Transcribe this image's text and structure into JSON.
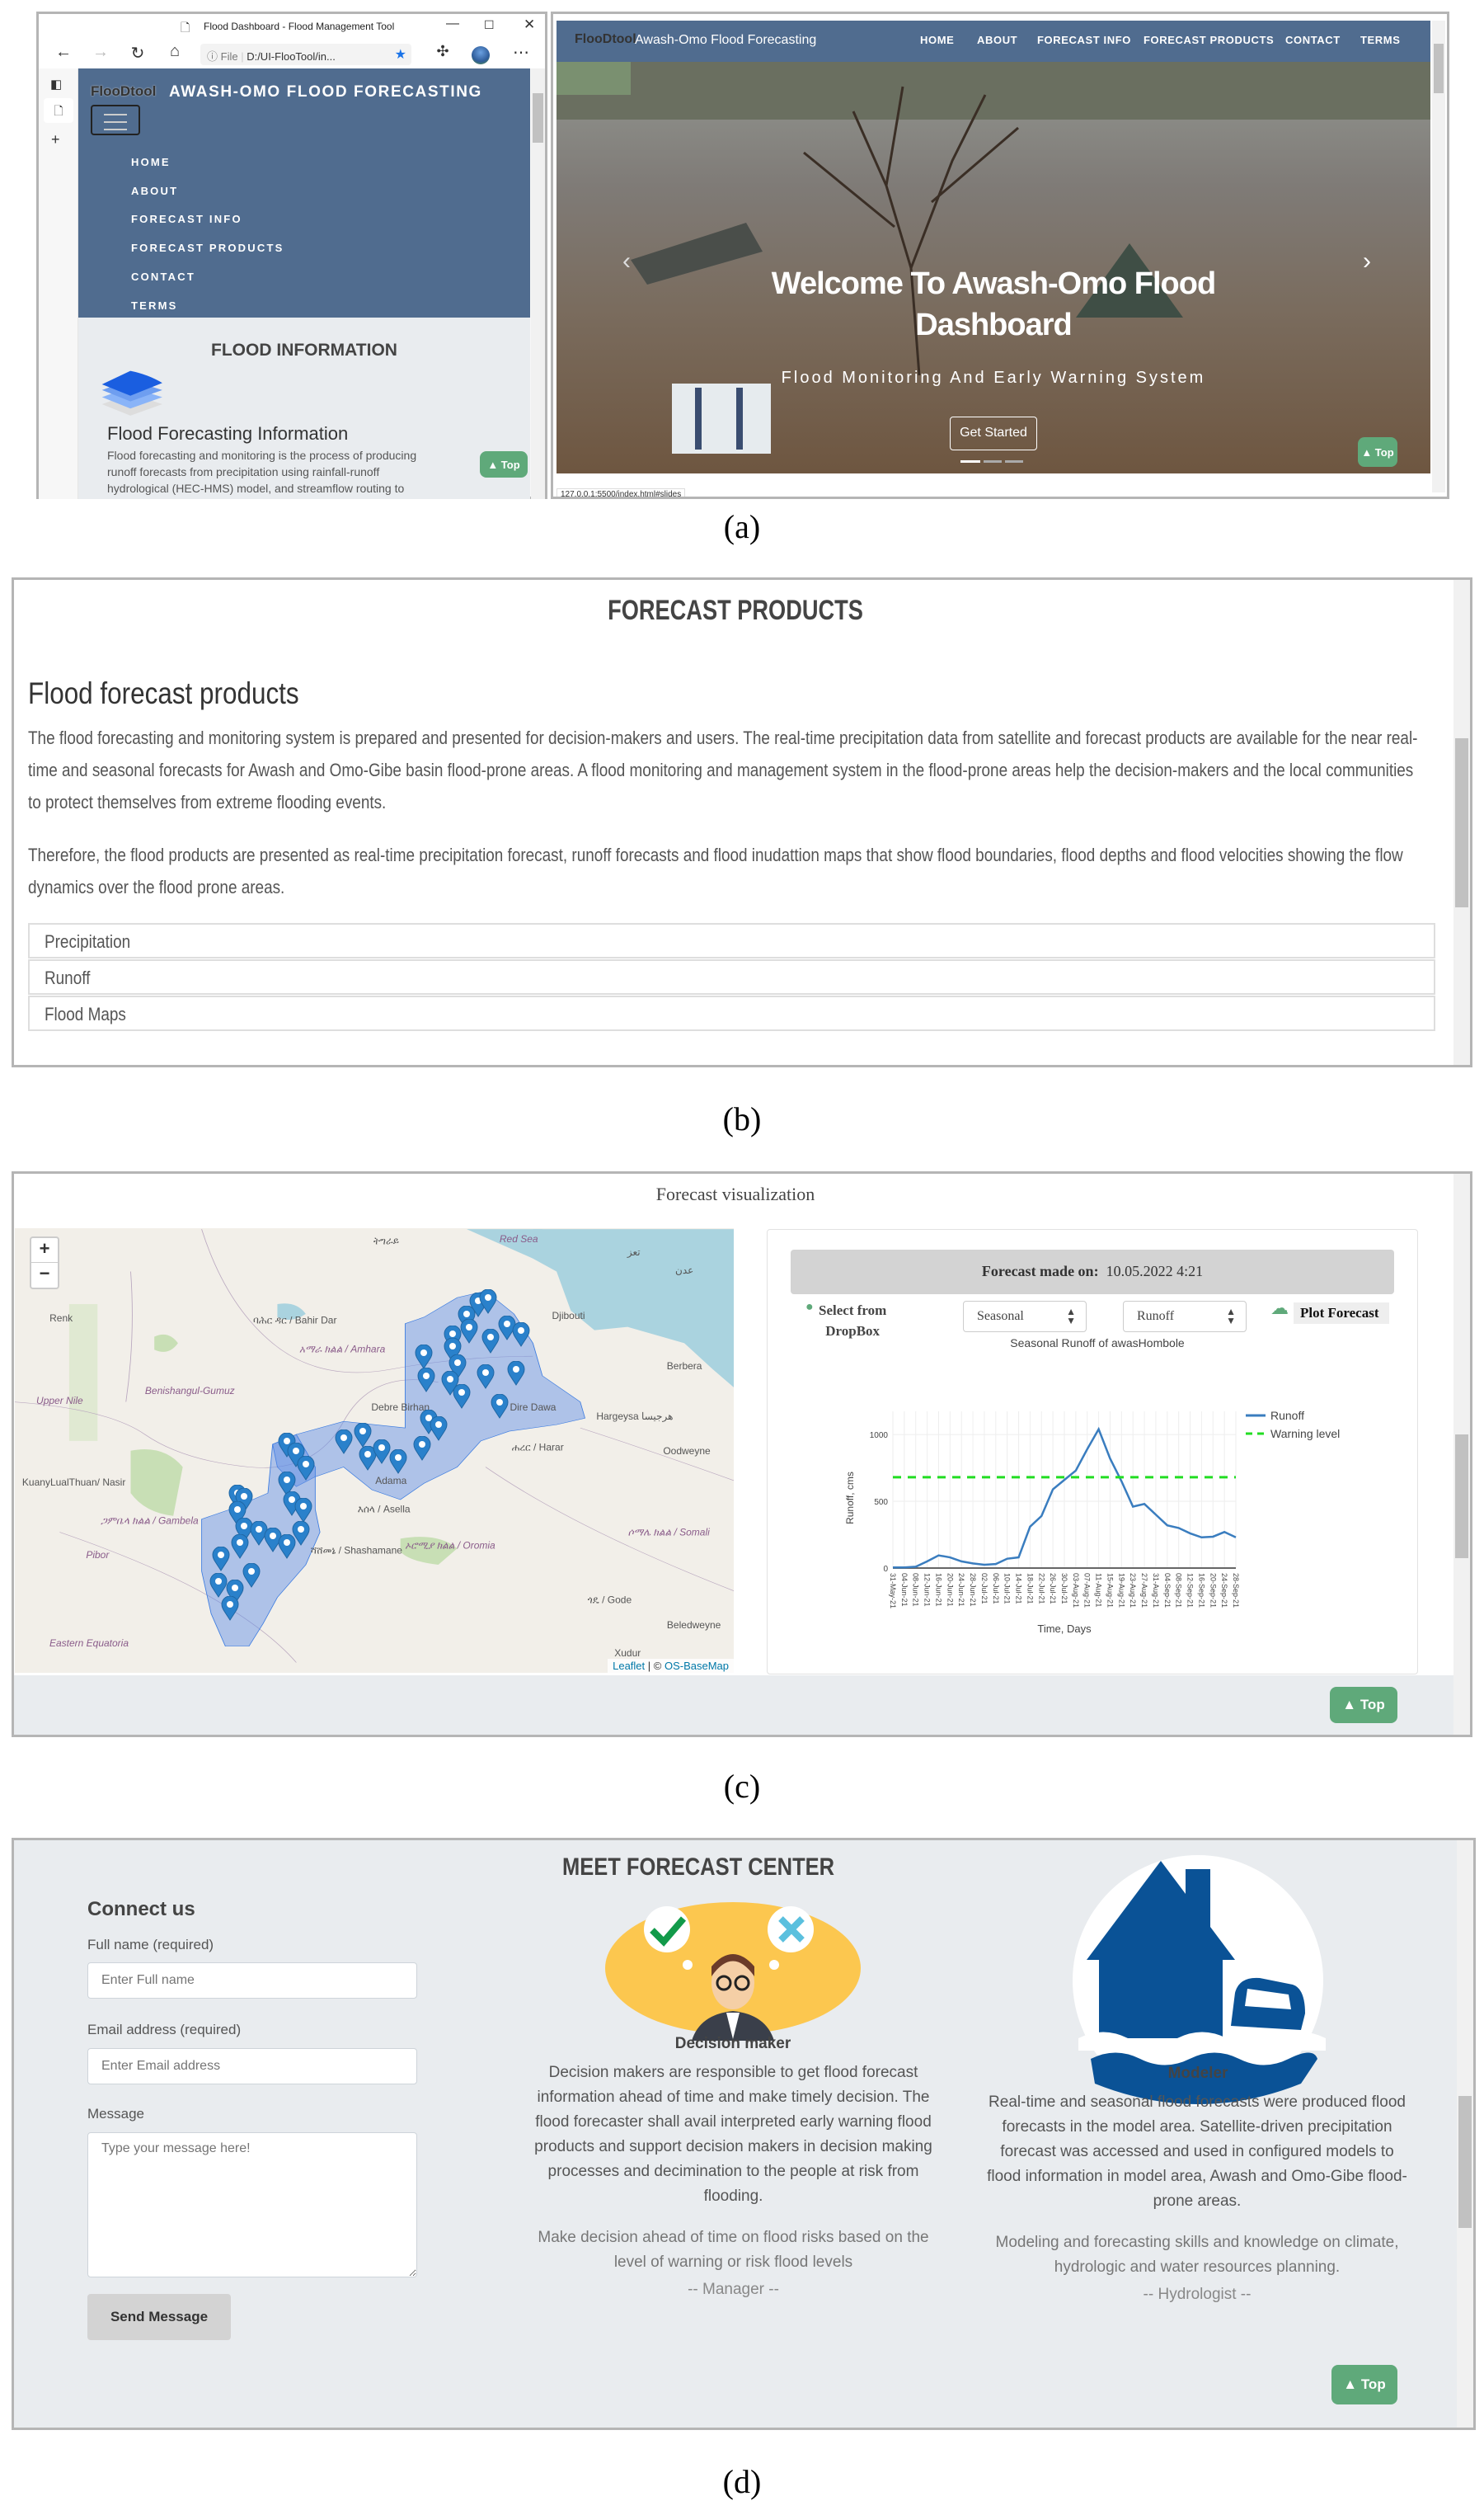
{
  "captions": {
    "a": "(a)",
    "b": "(b)",
    "c": "(c)",
    "d": "(d)"
  },
  "panel_a": {
    "mobile": {
      "window_title": "Flood Dashboard - Flood Management Tool",
      "address_scheme": "File",
      "address_url": "D:/UI-FlooTool/in...",
      "logo_text": "FlooDtool",
      "site_title": "AWASH-OMO FLOOD FORECASTING",
      "nav": [
        "HOME",
        "ABOUT",
        "FORECAST INFO",
        "FORECAST PRODUCTS",
        "CONTACT",
        "TERMS"
      ],
      "section_title": "FLOOD INFORMATION",
      "info_heading": "Flood Forecasting Information",
      "info_lines": [
        "Flood forecasting and monitoring is the process of producing",
        "runoff forecasts from precipitation using rainfall-runoff",
        "hydrological (HEC-HMS) model, and streamflow routing to"
      ],
      "top_label": "▲ Top"
    },
    "desktop": {
      "logo_text": "FlooDtool",
      "brand": "Awash-Omo Flood Forecasting",
      "nav": [
        "HOME",
        "ABOUT",
        "FORECAST INFO",
        "FORECAST PRODUCTS",
        "CONTACT",
        "TERMS"
      ],
      "hero_title_1": "Welcome To Awash-Omo Flood",
      "hero_title_2": "Dashboard",
      "hero_subtitle": "Flood Monitoring And Early Warning System",
      "cta": "Get Started",
      "prev": "‹",
      "next": "›",
      "status_url": "127.0.0.1:5500/index.html#slides",
      "top_label": "▲ Top"
    }
  },
  "panel_b": {
    "title": "FORECAST PRODUCTS",
    "heading": "Flood forecast products",
    "paragraph_1": "The flood forecasting and monitoring system is prepared and presented for decision-makers and users. The real-time precipitation data from satellite and forecast products are available for the near real-time and seasonal forecasts for Awash and Omo-Gibe basin flood-prone areas. A flood monitoring and management system in the flood-prone areas help the decision-makers and the local communities to protect themselves from extreme flooding events.",
    "paragraph_2": "Therefore, the flood products are presented as real-time precipitation forecast, runoff forecasts and flood inudattion maps that show flood boundaries, flood depths and flood velocities showing the flow dynamics over the flood prone areas.",
    "items": [
      "Precipitation",
      "Runoff",
      "Flood Maps"
    ]
  },
  "panel_c": {
    "title": "Forecast visualization",
    "map": {
      "zoom_in": "+",
      "zoom_out": "−",
      "attribution_leaflet": "Leaflet",
      "attribution_sep": " | © ",
      "attribution_base": "OS-BaseMap",
      "labels": [
        "Red Sea",
        "Djibouti",
        "ባሕር ዳር / Bahir Dar",
        "አማራ ክልል / Amhara",
        "Benishangul-Gumuz",
        "Upper Nile",
        "Renk",
        "Hargeysa هرجيسا",
        "Berbera",
        "Oodweyne",
        "ሐረር / Harar",
        "Dire Dawa",
        "እሰላ / Asella",
        "ሻሸመኔ / Shashamane",
        "ኦሮሚያ ክልል / Oromia",
        "ሶማሌ ክልል / Somali",
        "ጎዴ / Gode",
        "Beledweyne",
        "Xudur",
        "Eastern Equatoria",
        "Pibor",
        "ጋምቤላ ክልል / Gambela",
        "KuanyLualThuan/ Nasir",
        "Adama",
        "Debre Birhan",
        "تعز",
        "عدن",
        "ትግራይ"
      ]
    },
    "forecast_label": "Forecast made on:",
    "forecast_date": "10.05.2022 4:21",
    "select_from_1": "Select from",
    "select_from_2": "DropBox",
    "select_type": "Seasonal",
    "select_variable": "Runoff",
    "plot_button": "Plot Forecast",
    "top_label": "▲ Top"
  },
  "chart_data": {
    "type": "line",
    "title": "Seasonal Runoff of awasHombole",
    "xlabel": "Time, Days",
    "ylabel": "Runoff, cms",
    "ylim": [
      0,
      1050
    ],
    "yticks": [
      0,
      500,
      1000
    ],
    "categories": [
      "31-May-21",
      "04-Jun-21",
      "08-Jun-21",
      "12-Jun-21",
      "16-Jun-21",
      "20-Jun-21",
      "24-Jun-21",
      "28-Jun-21",
      "02-Jul-21",
      "06-Jul-21",
      "10-Jul-21",
      "14-Jul-21",
      "18-Jul-21",
      "22-Jul-21",
      "26-Jul-21",
      "30-Jul-21",
      "03-Aug-21",
      "07-Aug-21",
      "11-Aug-21",
      "15-Aug-21",
      "19-Aug-21",
      "23-Aug-21",
      "27-Aug-21",
      "31-Aug-21",
      "04-Sep-21",
      "08-Sep-21",
      "12-Sep-21",
      "16-Sep-21",
      "20-Sep-21",
      "24-Sep-21",
      "28-Sep-21"
    ],
    "series": [
      {
        "name": "Runoff",
        "color": "#3a7dbf",
        "values": [
          5,
          5,
          10,
          50,
          95,
          80,
          50,
          35,
          25,
          30,
          70,
          80,
          310,
          390,
          590,
          660,
          730,
          890,
          1040,
          820,
          650,
          460,
          480,
          400,
          320,
          300,
          260,
          230,
          235,
          270,
          230
        ]
      },
      {
        "name": "Warning level",
        "color": "#22dd22",
        "dashed": true,
        "values": [
          680,
          680,
          680,
          680,
          680,
          680,
          680,
          680,
          680,
          680,
          680,
          680,
          680,
          680,
          680,
          680,
          680,
          680,
          680,
          680,
          680,
          680,
          680,
          680,
          680,
          680,
          680,
          680,
          680,
          680,
          680
        ]
      }
    ],
    "legend": "right",
    "grid": true
  },
  "panel_d": {
    "connect_title": "Connect us",
    "name_label": "Full name (required)",
    "name_placeholder": "Enter Full name",
    "email_label": "Email address (required)",
    "email_placeholder": "Enter Email address",
    "message_label": "Message",
    "message_placeholder": "Type your message here!",
    "send": "Send Message",
    "center_title": "MEET FORECAST CENTER",
    "decision": {
      "name": "Decision maker",
      "text": "Decision makers are responsible to get flood forecast information ahead of time and make timely decision. The flood forecaster shall avail interpreted early warning flood products and support decision makers in decision making processes and decimination to the people at risk from flooding.",
      "quote": "Make decision ahead of time on flood risks based on the level of warning or risk flood levels",
      "role": "-- Manager --"
    },
    "modeler": {
      "name": "Modeler",
      "text": "Real-time and seasonal flood forecasts were produced flood forecasts in the model area. Satellite-driven precipitation forecast was accessed and used in configured models to flood information in model area, Awash and Omo-Gibe flood-prone areas.",
      "quote": "Modeling and forecasting skills and knowledge on climate, hydrologic and water resources planning.",
      "role": "-- Hydrologist --"
    },
    "top_label": "▲ Top"
  },
  "colors": {
    "nav": "#506c8f",
    "top_button": "#5fa97a",
    "content_bg": "#e9ecef"
  }
}
